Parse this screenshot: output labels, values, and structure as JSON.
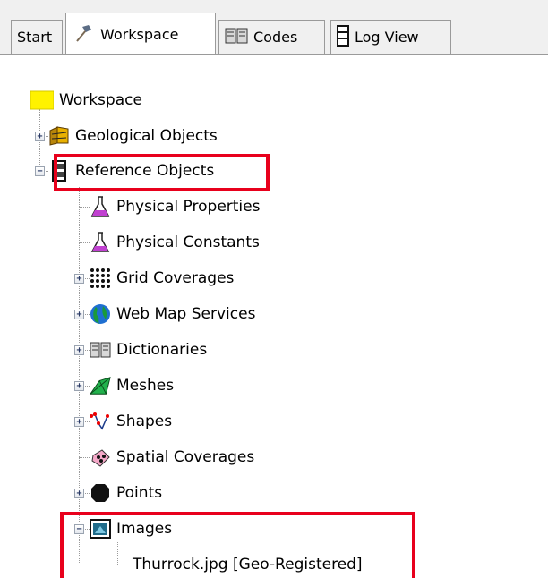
{
  "tabs": [
    {
      "label": "Start",
      "icon": "none"
    },
    {
      "label": "Workspace",
      "icon": "hammer-icon",
      "active": true
    },
    {
      "label": "Codes",
      "icon": "book-icon"
    },
    {
      "label": "Log View",
      "icon": "log-icon"
    }
  ],
  "tree": {
    "root": "Workspace",
    "geological_objects": "Geological Objects",
    "reference_objects": "Reference Objects",
    "children": [
      "Physical Properties",
      "Physical Constants",
      "Grid Coverages",
      "Web Map Services",
      "Dictionaries",
      "Meshes",
      "Shapes",
      "Spatial Coverages",
      "Points",
      "Images"
    ],
    "image_file": "Thurrock.jpg [Geo-Registered]"
  },
  "highlight_color": "#e8001c"
}
